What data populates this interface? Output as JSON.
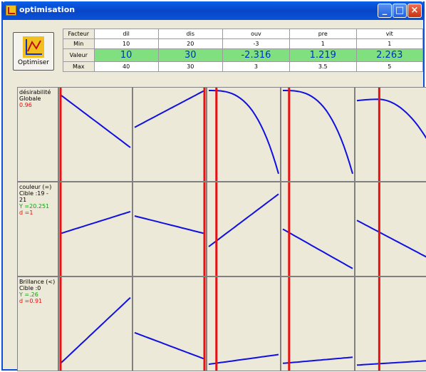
{
  "window": {
    "title": "optimisation"
  },
  "optimize_button": {
    "label": "Optimiser"
  },
  "params": {
    "row_labels": [
      "Facteur",
      "Min",
      "Valeur",
      "Max"
    ],
    "factors": [
      "dil",
      "dis",
      "ouv",
      "pre",
      "vit"
    ],
    "min": [
      "10",
      "20",
      "-3",
      "1",
      "1"
    ],
    "value": [
      "10",
      "30",
      "-2.316",
      "1.219",
      "2.263"
    ],
    "max": [
      "40",
      "30",
      "3",
      "3.5",
      "5"
    ]
  },
  "responses": [
    {
      "name": "désirabilité",
      "line2": "Globale",
      "line3": "0.96",
      "line4": ""
    },
    {
      "name": "couleur (=)",
      "line2": "Cible :19 - 21",
      "line3": "Y =20.251",
      "line4": "d =1"
    },
    {
      "name": "Brillance (<)",
      "line2": "Cible :0",
      "line3": "Y =.26",
      "line4": "d =0.91"
    }
  ],
  "colors": {
    "curve": "#1010e0",
    "marker": "#e81010",
    "value_bg": "#80e080"
  },
  "curves": [
    [
      {
        "fn": "line",
        "y0": 0.05,
        "y1": 0.65,
        "marker": 0.0
      },
      {
        "fn": "line",
        "y0": 0.42,
        "y1": 0.0,
        "marker": 1.0
      },
      {
        "fn": "convex",
        "y0": 0.0,
        "y1": 0.95,
        "marker": 0.11
      },
      {
        "fn": "convex",
        "y0": 0.0,
        "y1": 0.95,
        "marker": 0.09
      },
      {
        "fn": "peak",
        "y0": 0.1,
        "y1": 0.55,
        "marker": 0.32
      }
    ],
    [
      {
        "fn": "line",
        "y0": 0.55,
        "y1": 0.3,
        "marker": 0.0
      },
      {
        "fn": "line",
        "y0": 0.35,
        "y1": 0.55,
        "marker": 1.0
      },
      {
        "fn": "line",
        "y0": 0.7,
        "y1": 0.1,
        "marker": 0.11
      },
      {
        "fn": "line",
        "y0": 0.5,
        "y1": 0.95,
        "marker": 0.09
      },
      {
        "fn": "line",
        "y0": 0.4,
        "y1": 0.82,
        "marker": 0.32
      }
    ],
    [
      {
        "fn": "line",
        "y0": 0.95,
        "y1": 0.2,
        "marker": 0.0
      },
      {
        "fn": "line",
        "y0": 0.6,
        "y1": 0.9,
        "marker": 1.0
      },
      {
        "fn": "line",
        "y0": 0.96,
        "y1": 0.85,
        "marker": 0.11
      },
      {
        "fn": "line",
        "y0": 0.95,
        "y1": 0.88,
        "marker": 0.09
      },
      {
        "fn": "line",
        "y0": 0.97,
        "y1": 0.92,
        "marker": 0.32
      }
    ]
  ]
}
